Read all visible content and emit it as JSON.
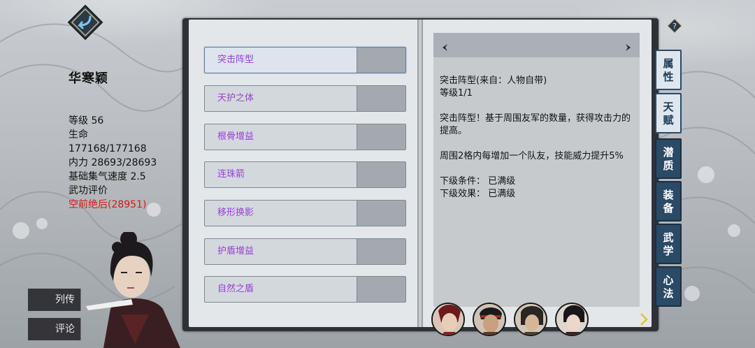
{
  "character": {
    "name": "华寒颖",
    "level": "等级 56",
    "hp_label": "生命",
    "hp_value": "177168/177168",
    "mp": "内力 28693/28693",
    "qi_speed": "基础集气速度 2.5",
    "rating_label": "武功评价",
    "rating_value": "空前绝后(28951)"
  },
  "side_buttons": {
    "biography": "列传",
    "comment": "评论"
  },
  "skills": [
    {
      "name": "突击阵型",
      "selected": true
    },
    {
      "name": "天护之体",
      "selected": false
    },
    {
      "name": "根骨增益",
      "selected": false
    },
    {
      "name": "连珠箭",
      "selected": false
    },
    {
      "name": "移形换影",
      "selected": false
    },
    {
      "name": "护盾增益",
      "selected": false
    },
    {
      "name": "自然之盾",
      "selected": false
    }
  ],
  "detail": {
    "title": "突击阵型(来自：人物自带)",
    "level": "等级1/1",
    "desc1": "突击阵型！基于周围友军的数量，获得攻击力的提高。",
    "desc2": "周围2格内每增加一个队友，技能威力提升5%",
    "next_condition": "下级条件： 已满级",
    "next_effect": "下级效果： 已满级"
  },
  "tabs": [
    {
      "label": "属性",
      "active": true
    },
    {
      "label": "天赋",
      "active": true
    },
    {
      "label": "潜质",
      "active": false
    },
    {
      "label": "装备",
      "active": false
    },
    {
      "label": "武学",
      "active": false
    },
    {
      "label": "心法",
      "active": false
    }
  ],
  "icons": {
    "back": "back-arrow-icon",
    "help": "question-icon",
    "prev": "chevron-left-icon",
    "next": "chevron-right-icon",
    "team_next": "arrow-right-icon"
  },
  "colors": {
    "skill_name": "#9a3fd1",
    "rating": "#d11a1a",
    "tab_blue": "#2a4a66",
    "book_frame": "#2e3237"
  }
}
